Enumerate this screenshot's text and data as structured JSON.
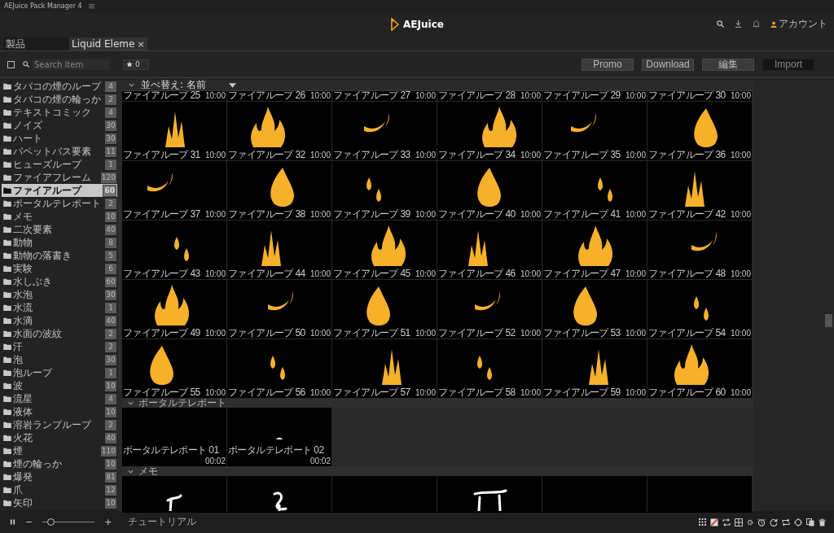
{
  "window": {
    "title": "AEJuice Pack Manager 4"
  },
  "header": {
    "logo": "AEJuice",
    "account": "アカウント"
  },
  "tabs": [
    {
      "label": "製品",
      "selected": false
    },
    {
      "label": "Liquid Eleme",
      "selected": true,
      "close": "×"
    }
  ],
  "toolbar": {
    "select_all": {
      "checked": false
    },
    "search": {
      "placeholder": "Search item"
    },
    "favorites": "0",
    "buttons": [
      {
        "label": "Promo",
        "kind": "normal"
      },
      {
        "label": "Download",
        "kind": "normal"
      },
      {
        "label": "編集",
        "kind": "normal"
      },
      {
        "label": "Import",
        "kind": "dark"
      }
    ]
  },
  "sidebar": {
    "items": [
      {
        "label": "タバコの煙のループ",
        "count": "4",
        "selected": false
      },
      {
        "label": "タバコの煙の輪っか",
        "count": "2",
        "selected": false
      },
      {
        "label": "テキストコミック",
        "count": "4",
        "selected": false
      },
      {
        "label": "ノイズ",
        "count": "30",
        "selected": false
      },
      {
        "label": "ハート",
        "count": "30",
        "selected": false
      },
      {
        "label": "パペットパス要素",
        "count": "11",
        "selected": false
      },
      {
        "label": "ヒューズループ",
        "count": "1",
        "selected": false
      },
      {
        "label": "ファイアフレーム",
        "count": "120",
        "selected": false
      },
      {
        "label": "ファイアループ",
        "count": "60",
        "selected": true
      },
      {
        "label": "ポータルテレポート",
        "count": "2",
        "selected": false
      },
      {
        "label": "メモ",
        "count": "10",
        "selected": false
      },
      {
        "label": "二次要素",
        "count": "40",
        "selected": false
      },
      {
        "label": "動物",
        "count": "8",
        "selected": false
      },
      {
        "label": "動物の落書き",
        "count": "5",
        "selected": false
      },
      {
        "label": "実験",
        "count": "6",
        "selected": false
      },
      {
        "label": "水しぶき",
        "count": "60",
        "selected": false
      },
      {
        "label": "水泡",
        "count": "30",
        "selected": false
      },
      {
        "label": "水流",
        "count": "1",
        "selected": false
      },
      {
        "label": "水滴",
        "count": "40",
        "selected": false
      },
      {
        "label": "水面の波紋",
        "count": "2",
        "selected": false
      },
      {
        "label": "汗",
        "count": "2",
        "selected": false
      },
      {
        "label": "泡",
        "count": "30",
        "selected": false
      },
      {
        "label": "泡ループ",
        "count": "1",
        "selected": false
      },
      {
        "label": "波",
        "count": "10",
        "selected": false
      },
      {
        "label": "流星",
        "count": "4",
        "selected": false
      },
      {
        "label": "液体",
        "count": "10",
        "selected": false
      },
      {
        "label": "溶岩ランプループ",
        "count": "2",
        "selected": false
      },
      {
        "label": "火花",
        "count": "40",
        "selected": false
      },
      {
        "label": "煙",
        "count": "110",
        "selected": false
      },
      {
        "label": "煙の輪っか",
        "count": "10",
        "selected": false
      },
      {
        "label": "爆発",
        "count": "81",
        "selected": false
      },
      {
        "label": "爪",
        "count": "12",
        "selected": false
      },
      {
        "label": "矢印",
        "count": "10",
        "selected": false
      }
    ]
  },
  "sort": {
    "label": "並べ替え: 名前"
  },
  "sections": [
    {
      "items": [
        {
          "name": "ファイアループ 25",
          "duration": "10:00"
        },
        {
          "name": "ファイアループ 26",
          "duration": "10:00"
        },
        {
          "name": "ファイアループ 27",
          "duration": "10:00"
        },
        {
          "name": "ファイアループ 28",
          "duration": "10:00"
        },
        {
          "name": "ファイアループ 29",
          "duration": "10:00"
        },
        {
          "name": "ファイアループ 30",
          "duration": "10:00"
        },
        {
          "name": "ファイアループ 31",
          "duration": "10:00"
        },
        {
          "name": "ファイアループ 32",
          "duration": "10:00"
        },
        {
          "name": "ファイアループ 33",
          "duration": "10:00"
        },
        {
          "name": "ファイアループ 34",
          "duration": "10:00"
        },
        {
          "name": "ファイアループ 35",
          "duration": "10:00"
        },
        {
          "name": "ファイアループ 36",
          "duration": "10:00"
        },
        {
          "name": "ファイアループ 37",
          "duration": "10:00"
        },
        {
          "name": "ファイアループ 38",
          "duration": "10:00"
        },
        {
          "name": "ファイアループ 39",
          "duration": "10:00"
        },
        {
          "name": "ファイアループ 40",
          "duration": "10:00"
        },
        {
          "name": "ファイアループ 41",
          "duration": "10:00"
        },
        {
          "name": "ファイアループ 42",
          "duration": "10:00"
        },
        {
          "name": "ファイアループ 43",
          "duration": "10:00"
        },
        {
          "name": "ファイアループ 44",
          "duration": "10:00"
        },
        {
          "name": "ファイアループ 45",
          "duration": "10:00"
        },
        {
          "name": "ファイアループ 46",
          "duration": "10:00"
        },
        {
          "name": "ファイアループ 47",
          "duration": "10:00"
        },
        {
          "name": "ファイアループ 48",
          "duration": "10:00"
        },
        {
          "name": "ファイアループ 49",
          "duration": "10:00"
        },
        {
          "name": "ファイアループ 50",
          "duration": "10:00"
        },
        {
          "name": "ファイアループ 51",
          "duration": "10:00"
        },
        {
          "name": "ファイアループ 52",
          "duration": "10:00"
        },
        {
          "name": "ファイアループ 53",
          "duration": "10:00"
        },
        {
          "name": "ファイアループ 54",
          "duration": "10:00"
        },
        {
          "name": "ファイアループ 55",
          "duration": "10:00"
        },
        {
          "name": "ファイアループ 56",
          "duration": "10:00"
        },
        {
          "name": "ファイアループ 57",
          "duration": "10:00"
        },
        {
          "name": "ファイアループ 58",
          "duration": "10:00"
        },
        {
          "name": "ファイアループ 59",
          "duration": "10:00"
        },
        {
          "name": "ファイアループ 60",
          "duration": "10:00"
        }
      ]
    },
    {
      "title": "ポータルテレポート",
      "expanded": true,
      "items": [
        {
          "name": "ポータルテレポート 01",
          "duration": "00:02"
        },
        {
          "name": "ポータルテレポート 02",
          "duration": "00:02"
        }
      ]
    },
    {
      "title": "メモ",
      "expanded": true,
      "items": [
        {
          "kind": "picture"
        },
        {
          "kind": "picture"
        },
        {
          "kind": "blank"
        },
        {
          "kind": "picture"
        },
        {
          "kind": "blank"
        },
        {
          "kind": "blank"
        }
      ]
    }
  ],
  "bottom_bar": {
    "minus": "−",
    "plus": "+",
    "zoom": {
      "level": 0.15
    },
    "tutorial": "チュートリアル"
  }
}
